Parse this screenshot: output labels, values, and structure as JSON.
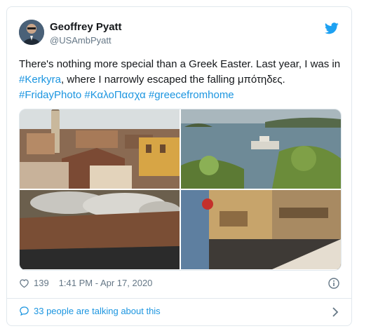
{
  "tweet": {
    "author_name": "Geoffrey Pyatt",
    "author_handle": "@USAmbPyatt",
    "text_part1": "There's nothing more special than a Greek Easter. Last year, I was in ",
    "link_kerkyra": "#Kerkyra",
    "text_part2": ", where I narrowly escaped the falling μπότηδες.",
    "hashtag_1": "#FridayPhoto",
    "hashtag_2": "#ΚαλοΠασχα",
    "hashtag_3": "#greecefromhome",
    "likes": "139",
    "timestamp": "1:41 PM - Apr 17, 2020",
    "talking": "33 people are talking about this"
  },
  "colors": {
    "link": "#1b95e0",
    "muted": "#657786",
    "border": "#e1e8ed"
  },
  "icons": [
    "twitter-bird-icon",
    "heart-icon",
    "info-icon",
    "speech-bubble-icon",
    "chevron-right-icon"
  ]
}
